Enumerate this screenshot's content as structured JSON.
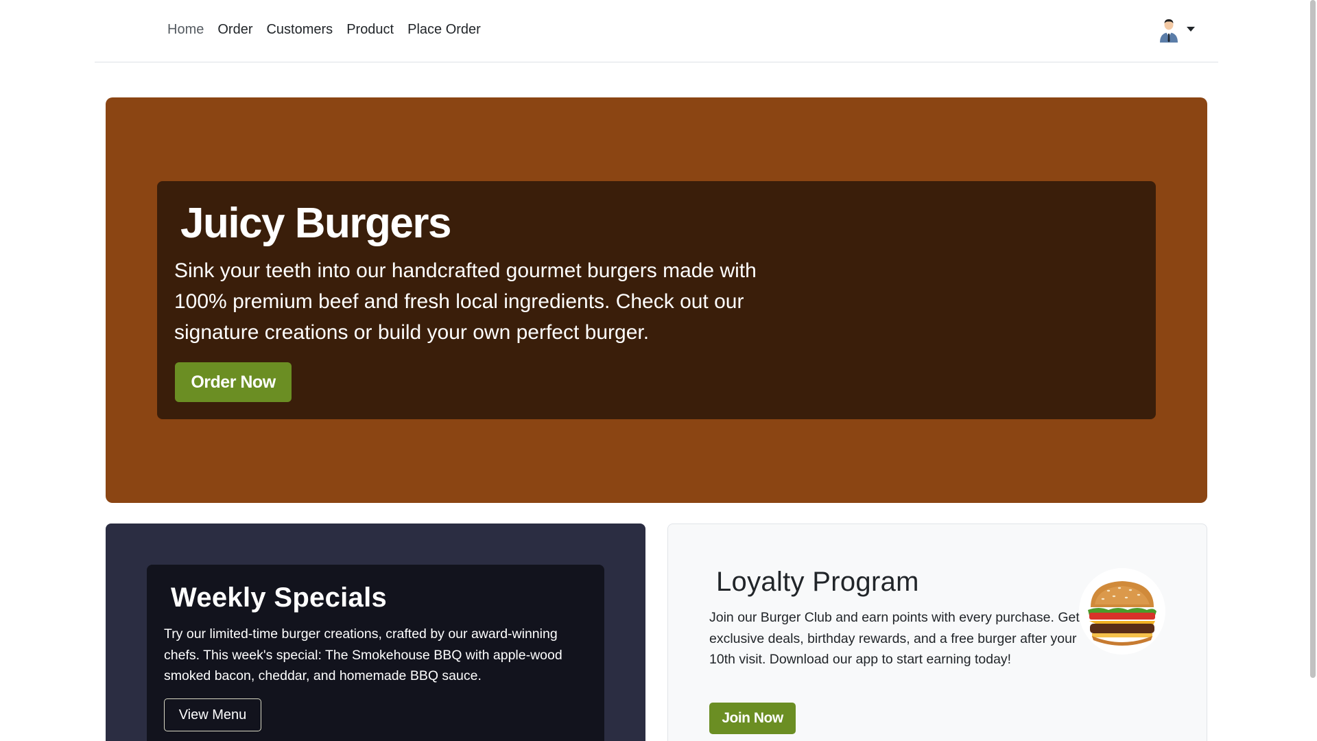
{
  "nav": {
    "links": [
      "Home",
      "Order",
      "Customers",
      "Product",
      "Place Order"
    ],
    "active_index": 0,
    "user_avatar_icon": "user-avatar-icon",
    "dropdown_icon": "caret-down-icon"
  },
  "hero": {
    "title": "Juicy Burgers",
    "text": "Sink your teeth into our handcrafted gourmet burgers made with 100% premium beef and fresh local ingredients. Check out our signature creations or build your own perfect burger.",
    "button_label": "Order Now"
  },
  "specials": {
    "title": "Weekly Specials",
    "text": "Try our limited-time burger creations, crafted by our award-winning chefs. This week's special: The Smokehouse BBQ with apple-wood smoked bacon, cheddar, and homemade BBQ sauce.",
    "button_label": "View Menu"
  },
  "loyalty": {
    "title": "Loyalty Program",
    "text": "Join our Burger Club and earn points with every purchase. Get exclusive deals, birthday rewards, and a free burger after your 10th visit. Download our app to start earning today!",
    "button_label": "Join Now",
    "image_icon": "burger-image"
  },
  "colors": {
    "hero_bg": "#8b4513",
    "hero_inner_bg": "#3a1e0a",
    "accent_green": "#6b8e23",
    "specials_bg": "#2b2d42",
    "specials_inner_bg": "#12131d",
    "loyalty_bg": "#f8f9fa"
  }
}
